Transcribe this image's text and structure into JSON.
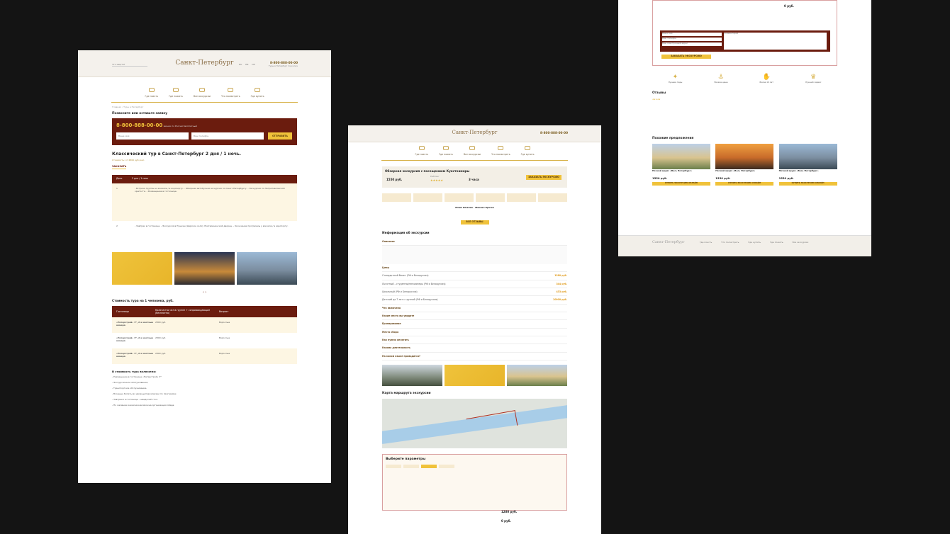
{
  "page1": {
    "search_placeholder": "Что ищете?",
    "logo": "Санкт-Петербург",
    "langs": "RU EN DE",
    "phone": "8-800-888-00-00",
    "phone_sub": "Туры в Петербург под ключ",
    "nav": [
      "Где поесть",
      "Где пожить",
      "Все экскурсии",
      "Что посмотреть",
      "Где купить"
    ],
    "breadcrumb": "Главная › Туры в Петербург",
    "call_title": "Позвоните или оставьте заявку",
    "call_phone": "8-800-888-00-00",
    "call_sub": "звонок по России бесплатный",
    "name_ph": "Ваше имя",
    "tel_ph": "Ваш телефон",
    "send": "ОТПРАВИТЬ",
    "tour_title": "Классический тур в Санкт-Петербург 2 дня / 1 ночь.",
    "tour_price": "Стоимость: от 2800 руб./чел.",
    "order": "ЗАКАЗАТЬ",
    "days_head": [
      "День",
      "2 дня / 1 ночь"
    ],
    "days": [
      {
        "n": "1",
        "t": "- Встреча группы на вокзале / в аэропорту. - Обзорная автобусная экскурсия по Санкт-Петербургу. - Экскурсия по Петропавловской крепости. - Размещение в гостинице."
      },
      {
        "n": "2",
        "t": "- Завтрак в гостинице. - Экскурсия в Пушкин (Царское село): Екатерининский дворец. - Окончание программы у вокзала / в аэропорту."
      }
    ],
    "cost_title": "Стоимость тура на 1 человека, руб.",
    "cost_head": [
      "Гостиница",
      "Количество чел в группе + сопровождающие (бесплатно)",
      "Возраст"
    ],
    "cost_rows": [
      {
        "h": "«Петерстрой» 3*, 2-х местные номера",
        "p": "2800 руб.",
        "a": "Взрослые"
      },
      {
        "h": "«Петерстрой» 3*, 2-х местные номера",
        "p": "2800 руб.",
        "a": "Взрослые"
      },
      {
        "h": "«Петерстрой» 3*, 2-х местные номера",
        "p": "2800 руб.",
        "a": "Взрослые"
      }
    ],
    "incl_title": "В стоимость тура включено:",
    "incl": [
      "- Размещение в гостинице «Петерстрой» 3*",
      "- Экскурсионное обслуживание;",
      "- Транспортное обслуживание.",
      "- Входные билеты во дворцы/парки/музеи по программе;",
      "- Завтраки в гостинице - шведский стол.",
      "- По желанию заказчика возможна организация обеда."
    ]
  },
  "page2": {
    "logo": "Санкт-Петербург",
    "phone": "8-800-888-00-00",
    "nav": [
      "Где поесть",
      "Где пожить",
      "Все экскурсии",
      "Что посмотреть",
      "Где купить"
    ],
    "tour_title": "Обзорная экскурсия с посещением Кунсткамеры",
    "price": "1550 руб.",
    "rating_label": "Рейтинг",
    "duration": "3 часа",
    "book": "ЗАКАЗАТЬ ЭКСКУРСИЮ",
    "review_author": "Юлия Шевлин · Михаил Брагин",
    "all_reviews": "ВСЕ ОТЗЫВЫ",
    "info_title": "Информация об экскурсии",
    "desc_label": "Описание",
    "prices_label": "Цены",
    "price_rows": [
      {
        "l": "Стандартный билет (РФ и Белоруссия)",
        "v": "1380 руб."
      },
      {
        "l": "Льготный – студенты/пенсионеры (РФ и Белоруссия)",
        "v": "344 руб."
      },
      {
        "l": "Школьный (РФ и Белоруссия)",
        "v": "433 руб."
      },
      {
        "l": "Детский до 7 лет с группой (РФ и Белоруссия)",
        "v": "10000 руб."
      }
    ],
    "info_rows": [
      "Что включено",
      "Какие места вы увидите",
      "Бронирование",
      "Место сбора",
      "Как нужно оплатить",
      "Какова длительность",
      "На каком языке проводится?"
    ],
    "map_title": "Карта маршрута экскурсии",
    "params_title": "Выберите параметры",
    "sum": "1280 руб.",
    "sum2": "0 руб."
  },
  "page3": {
    "sum": "0 руб.",
    "name_ph": "Ваше имя",
    "tel_ph": "Ваш телефон",
    "email_ph": "Ваш электронный адрес",
    "comment_ph": "Комментарий",
    "submit": "ЗАКАЗАТЬ ЭКСКУРСИЮ",
    "features": [
      "Лучшие гиды",
      "Низкие цены",
      "Более 10 лет",
      "Лучший сервис"
    ],
    "reviews_title": "Отзывы",
    "similar_title": "Похожие предложения",
    "cards": [
      {
        "t": "Ночной круиз «Весь Петербург»",
        "p": "1550 руб."
      },
      {
        "t": "Ночной круиз «Весь Петербург»",
        "p": "1550 руб."
      },
      {
        "t": "Ночной круиз «Весь Петербург»",
        "p": "1550 руб."
      }
    ],
    "card_btn": "КУПИТЬ ЭКСКУРСИЮ ОНЛАЙН",
    "footer_logo": "Санкт-Петербург",
    "footer_links": [
      "Где поесть",
      "Что посмотреть",
      "Где купить",
      "Где пожить",
      "Все экскурсии"
    ]
  }
}
